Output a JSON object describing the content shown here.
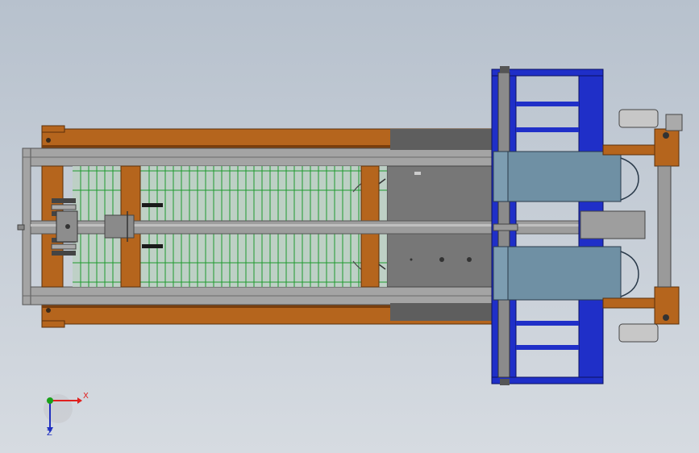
{
  "viewport": {
    "background_top": "#b7c1cd",
    "background_bottom": "#d6dbe1"
  },
  "colors": {
    "wood": "#b5651d",
    "wood_dark": "#7a3e0c",
    "frame_gray": "#9a9a9a",
    "frame_dark": "#5a5a5a",
    "plate": "#777777",
    "mesh": "#1e9a2e",
    "mesh_bg": "#cfe0cf",
    "blue": "#1f2fc8",
    "steel_blue": "#6f90a4",
    "axis_x": "#e0201e",
    "axis_y": "#18a018",
    "axis_z": "#2030c0"
  },
  "triad": {
    "x_label": "X",
    "z_label": "Z",
    "x_icon": "x-axis-arrow",
    "y_icon": "y-axis-dot",
    "z_icon": "z-axis-arrow"
  }
}
